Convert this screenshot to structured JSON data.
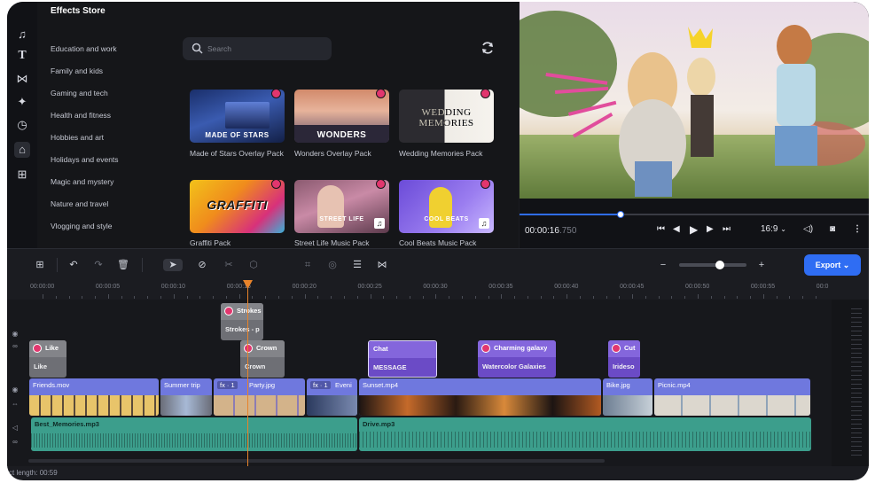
{
  "effects_store": {
    "title": "Effects Store",
    "categories": [
      "Education and work",
      "Family and kids",
      "Gaming and tech",
      "Health and fitness",
      "Hobbies and art",
      "Holidays and events",
      "Magic and mystery",
      "Nature and travel",
      "Vlogging and style"
    ],
    "search_placeholder": "Search",
    "cards": [
      {
        "label": "Made of Stars Overlay Pack",
        "overlay": "MADE OF STARS"
      },
      {
        "label": "Wonders Overlay Pack",
        "overlay": "WONDERS"
      },
      {
        "label": "Wedding Memories Pack",
        "overlay": "WEDDING MEMORIES"
      },
      {
        "label": "Graffiti Pack",
        "overlay": "GRAFFITI"
      },
      {
        "label": "Street Life Music Pack",
        "overlay": "STREET LIFE"
      },
      {
        "label": "Cool Beats Music Pack",
        "overlay": "COOL BEATS"
      }
    ]
  },
  "preview": {
    "timecode_main": "00:00:16",
    "timecode_ms": ".750",
    "aspect_ratio": "16:9",
    "progress": 0.29
  },
  "toolbar": {
    "export_label": "Export",
    "zoom_level": 0.6
  },
  "ruler": {
    "ticks": [
      "00:00:00",
      "00:00:05",
      "00:00:10",
      "00:00:15",
      "00:00:20",
      "00:00:25",
      "00:00:30",
      "00:00:35",
      "00:00:40",
      "00:00:45",
      "00:00:50",
      "00:00:55",
      "00:0"
    ]
  },
  "timeline": {
    "fx_clips": [
      {
        "name": "Strokes",
        "sub": "Strokes - p"
      },
      {
        "name": "Like",
        "sub": "Like"
      },
      {
        "name": "Crown",
        "sub": "Crown"
      },
      {
        "name": "Chat",
        "sub": "MESSAGE"
      },
      {
        "name": "Charming galaxy",
        "sub": "Watercolor Galaxies"
      },
      {
        "name": "Cut",
        "sub": "Irideso"
      }
    ],
    "video_clips": [
      "Friends.mov",
      "Summer trip",
      "fx · 1",
      "Party.jpg",
      "fx · 1",
      "Eveni",
      "Sunset.mp4",
      "Bike.jpg",
      "Picnic.mp4"
    ],
    "audio_clips": [
      "Best_Memories.mp3",
      "Drive.mp3"
    ],
    "project_length": "ct length: 00:59"
  },
  "colors": {
    "accent": "#2f6df3",
    "premium": "#e2366e",
    "playhead": "#e8832a",
    "video_clip": "#6f78de",
    "audio_clip": "#3c9e8c",
    "fx_clip_purple": "#6b4bc6"
  }
}
